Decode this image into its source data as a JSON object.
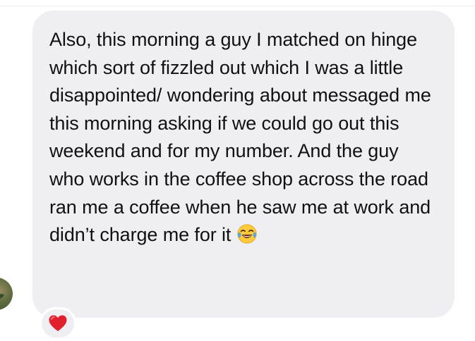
{
  "message": {
    "text": "Also, this morning a guy I matched on hinge which sort of fizzled out which I was a little disappointed/ wondering about messaged me this morning asking if we could go out this weekend and for my number. And the guy who works in the coffee shop across the road ran me a coffee when he saw me at work and didn’t charge me for it",
    "emoji": "face-with-tears-of-joy",
    "bubble_color": "#efeff3",
    "text_color": "#111111"
  },
  "reaction": {
    "icon": "red-heart-icon",
    "color": "#e0202e"
  },
  "avatar": {
    "icon": "avatar"
  }
}
